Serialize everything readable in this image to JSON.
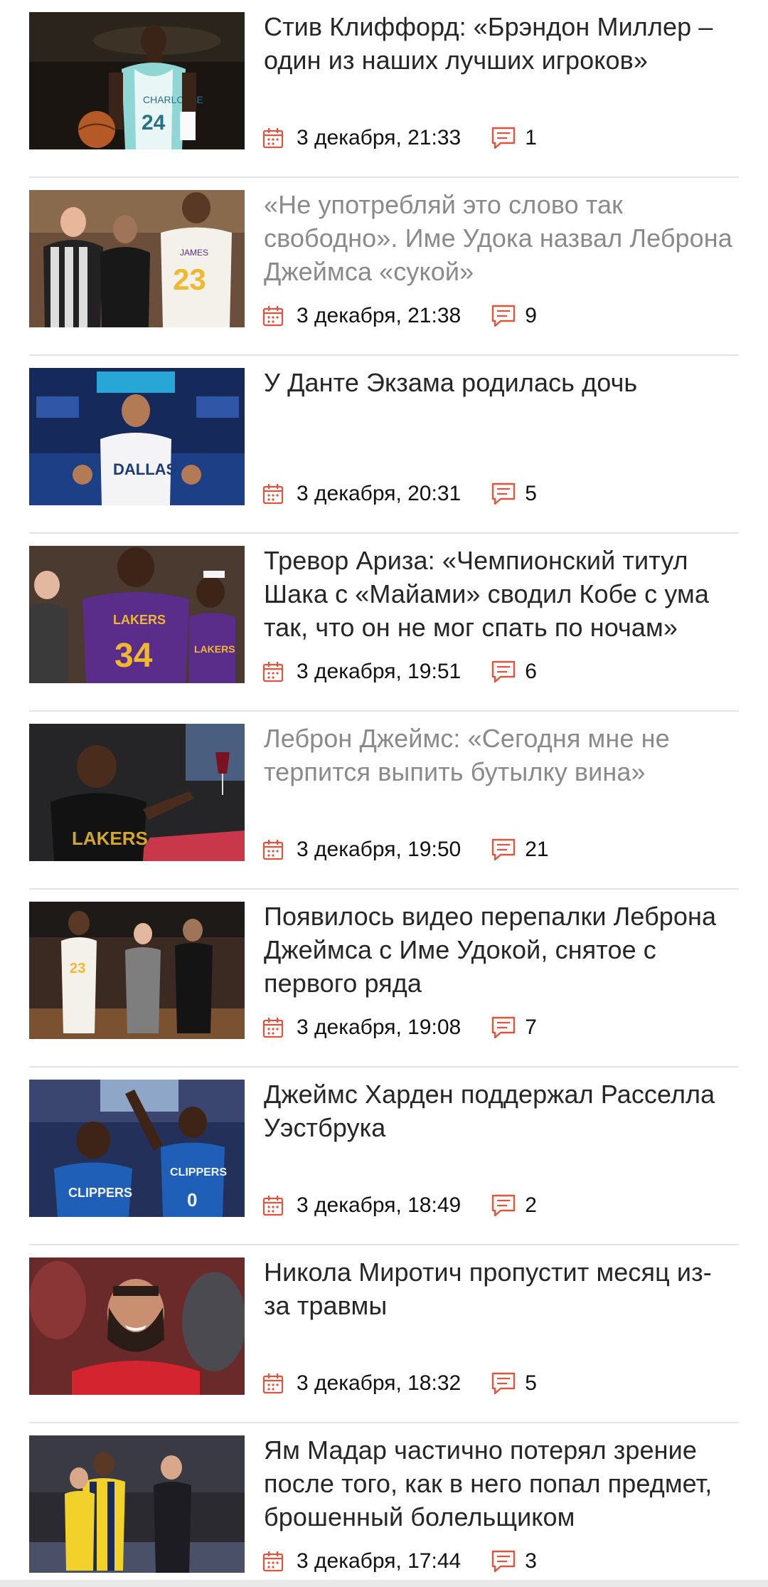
{
  "colors": {
    "accent": "#e0533d",
    "separator": "#e3e3e3"
  },
  "news": [
    {
      "title": "Стив Клиффорд: «Брэндон Миллер – один из наших лучших игроков»",
      "date": "3 декабря, 21:33",
      "comments": "1",
      "read": false,
      "image": "player-charlotte-24-photo"
    },
    {
      "title": "«Не употребляй это слово так свободно». Име Удока назвал Леброна Джеймса «сукой»",
      "date": "3 декабря, 21:38",
      "comments": "9",
      "read": true,
      "image": "referee-udoka-james-photo"
    },
    {
      "title": "У Данте Экзама родилась дочь",
      "date": "3 декабря, 20:31",
      "comments": "5",
      "read": false,
      "image": "player-dallas-photo"
    },
    {
      "title": "Тревор Ариза: «Чемпионский титул Шака с «Майами» сводил Кобе с ума так, что он не мог спать по ночам»",
      "date": "3 декабря, 19:51",
      "comments": "6",
      "read": false,
      "image": "lakers-players-photo"
    },
    {
      "title": "Леброн Джеймс: «Сегодня мне не терпится выпить бутылку вина»",
      "date": "3 декабря, 19:50",
      "comments": "21",
      "read": true,
      "image": "lebron-wine-photo"
    },
    {
      "title": "Появилось видео перепалки Леброна Джеймса с Име Удокой, снятое с первого ряда",
      "date": "3 декабря, 19:08",
      "comments": "7",
      "read": false,
      "image": "court-argument-photo"
    },
    {
      "title": "Джеймс Харден поддержал Расселла Уэстбрука",
      "date": "3 декабря, 18:49",
      "comments": "2",
      "read": false,
      "image": "clippers-players-photo"
    },
    {
      "title": "Никола Миротич пропустит месяц из-за травмы",
      "date": "3 декабря, 18:32",
      "comments": "5",
      "read": false,
      "image": "mirotic-photo"
    },
    {
      "title": "Ям Мадар частично потерял зрение после того, как в него попал предмет, брошенный болельщиком",
      "date": "3 декабря, 17:44",
      "comments": "3",
      "read": false,
      "image": "fenerbahce-players-photo"
    }
  ]
}
